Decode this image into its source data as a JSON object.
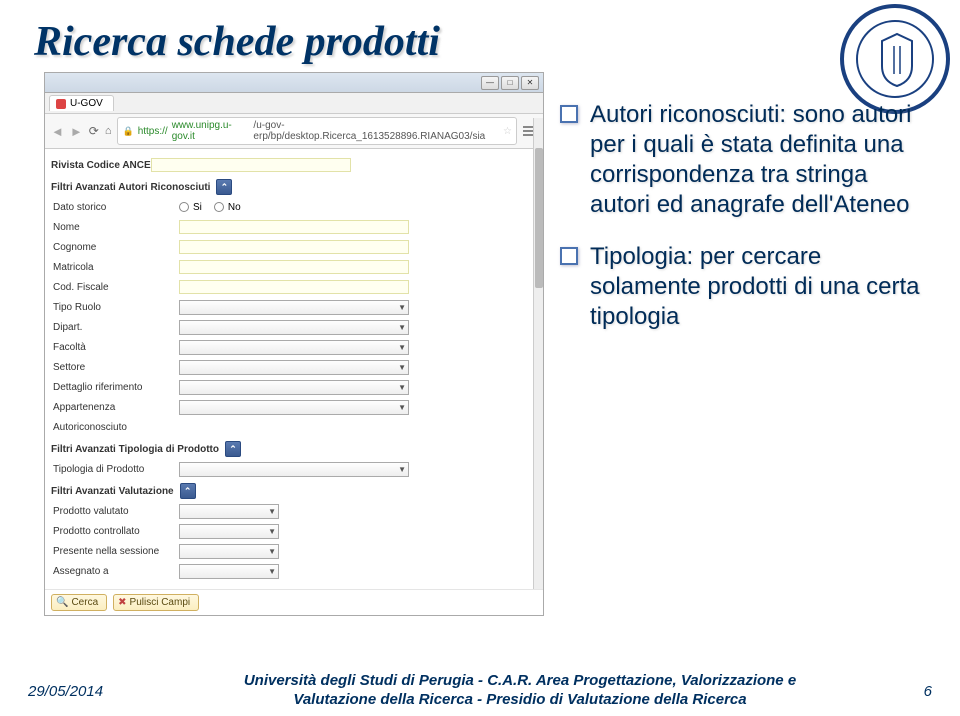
{
  "title": "Ricerca schede prodotti",
  "browser": {
    "tab_label": "U-GOV",
    "url_prefix": "https://",
    "url_host": "www.unipg.u-gov.it",
    "url_path": "/u-gov-erp/bp/desktop.Ricerca_1613528896.RIANAG03/sia"
  },
  "form": {
    "sec0": "Rivista Codice ANCE",
    "sec1": "Filtri Avanzati Autori Riconosciuti",
    "f_datostorico": "Dato storico",
    "r_si": "Si",
    "r_no": "No",
    "f_nome": "Nome",
    "f_cognome": "Cognome",
    "f_matricola": "Matricola",
    "f_codfiscale": "Cod. Fiscale",
    "f_tiporuolo": "Tipo Ruolo",
    "f_dipart": "Dipart.",
    "f_facolta": "Facoltà",
    "f_settore": "Settore",
    "f_dettaglio": "Dettaglio riferimento",
    "f_appartenenza": "Appartenenza",
    "f_autoriconosciuto": "Autoriconosciuto",
    "sec2": "Filtri Avanzati Tipologia di Prodotto",
    "f_tipologia": "Tipologia di Prodotto",
    "sec3": "Filtri Avanzati Valutazione",
    "f_valutato": "Prodotto valutato",
    "f_controllato": "Prodotto controllato",
    "f_presente": "Presente nella sessione",
    "f_assegnato": "Assegnato a",
    "btn_cerca": "Cerca",
    "btn_pulisci": "Pulisci Campi"
  },
  "bullets": {
    "b1": "Autori riconosciuti: sono autori per i quali è stata definita una corrispondenza tra stringa autori ed anagrafe dell'Ateneo",
    "b2": "Tipologia: per cercare solamente prodotti di una certa tipologia"
  },
  "footer": {
    "date": "29/05/2014",
    "line1": "Università degli Studi di Perugia - C.A.R. Area Progettazione, Valorizzazione e",
    "line2": "Valutazione della Ricerca - Presidio di Valutazione della Ricerca",
    "page": "6"
  }
}
